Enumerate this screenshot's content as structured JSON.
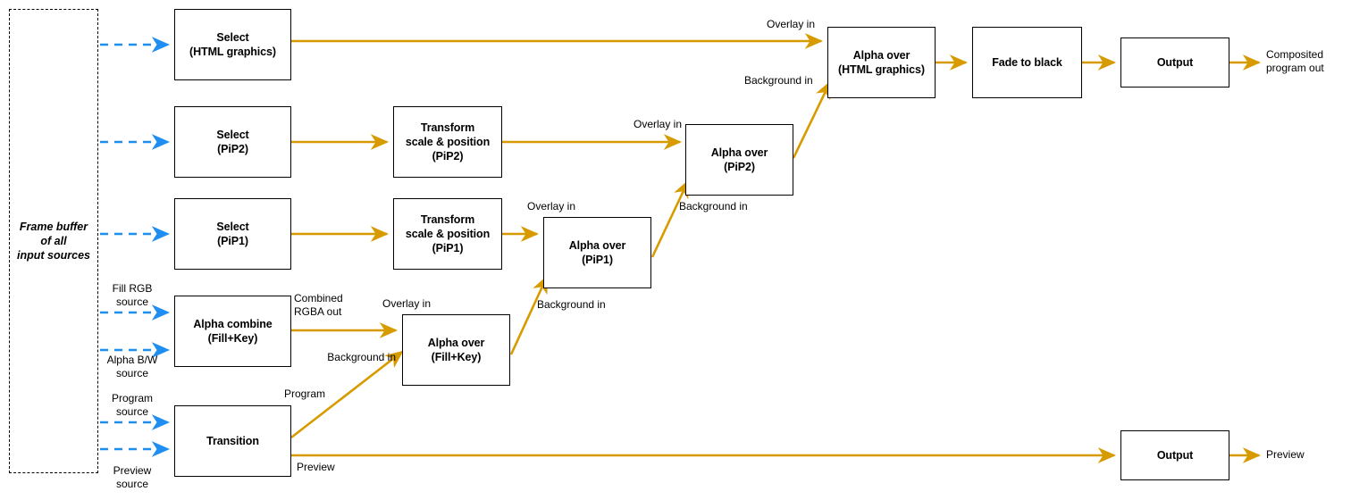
{
  "diagram": {
    "title": "Video mixer compositing signal flow",
    "colors": {
      "signal_arrow": "#D79B00",
      "source_arrow": "#1F8EF1",
      "node_border": "#000000",
      "node_fill": "#FFFFFF",
      "text": "#000000"
    },
    "frame_buffer": {
      "label": "Frame buffer\nof all\ninput sources"
    },
    "nodes": [
      {
        "id": "select_html",
        "label": "Select\n(HTML graphics)"
      },
      {
        "id": "select_pip2",
        "label": "Select\n(PiP2)"
      },
      {
        "id": "select_pip1",
        "label": "Select\n(PiP1)"
      },
      {
        "id": "alpha_combine",
        "label": "Alpha combine\n(Fill+Key)"
      },
      {
        "id": "transition",
        "label": "Transition"
      },
      {
        "id": "transform_pip2",
        "label": "Transform\nscale & position\n(PiP2)"
      },
      {
        "id": "transform_pip1",
        "label": "Transform\nscale & position\n(PiP1)"
      },
      {
        "id": "alpha_over_fk",
        "label": "Alpha over\n(Fill+Key)"
      },
      {
        "id": "alpha_over_p1",
        "label": "Alpha over\n(PiP1)"
      },
      {
        "id": "alpha_over_p2",
        "label": "Alpha over\n(PiP2)"
      },
      {
        "id": "alpha_over_html",
        "label": "Alpha over\n(HTML graphics)"
      },
      {
        "id": "fade_to_black",
        "label": "Fade to black"
      },
      {
        "id": "output_program",
        "label": "Output"
      },
      {
        "id": "output_preview",
        "label": "Output"
      }
    ],
    "source_labels": {
      "fill_rgb": "Fill RGB\nsource",
      "alpha_bw": "Alpha B/W\nsource",
      "program": "Program\nsource",
      "preview": "Preview\nsource"
    },
    "edge_labels": {
      "combined_rgba_out": "Combined\nRGBA out",
      "overlay_in_fk": "Overlay in",
      "background_in_fk": "Background in",
      "program": "Program",
      "preview": "Preview",
      "overlay_in_p1": "Overlay in",
      "background_in_p1": "Background in",
      "overlay_in_p2": "Overlay in",
      "background_in_p2": "Background in",
      "overlay_in_html": "Overlay in",
      "background_in_html": "Background in"
    },
    "outputs": {
      "composited_program_out": "Composited\nprogram out",
      "preview_out": "Preview"
    }
  }
}
